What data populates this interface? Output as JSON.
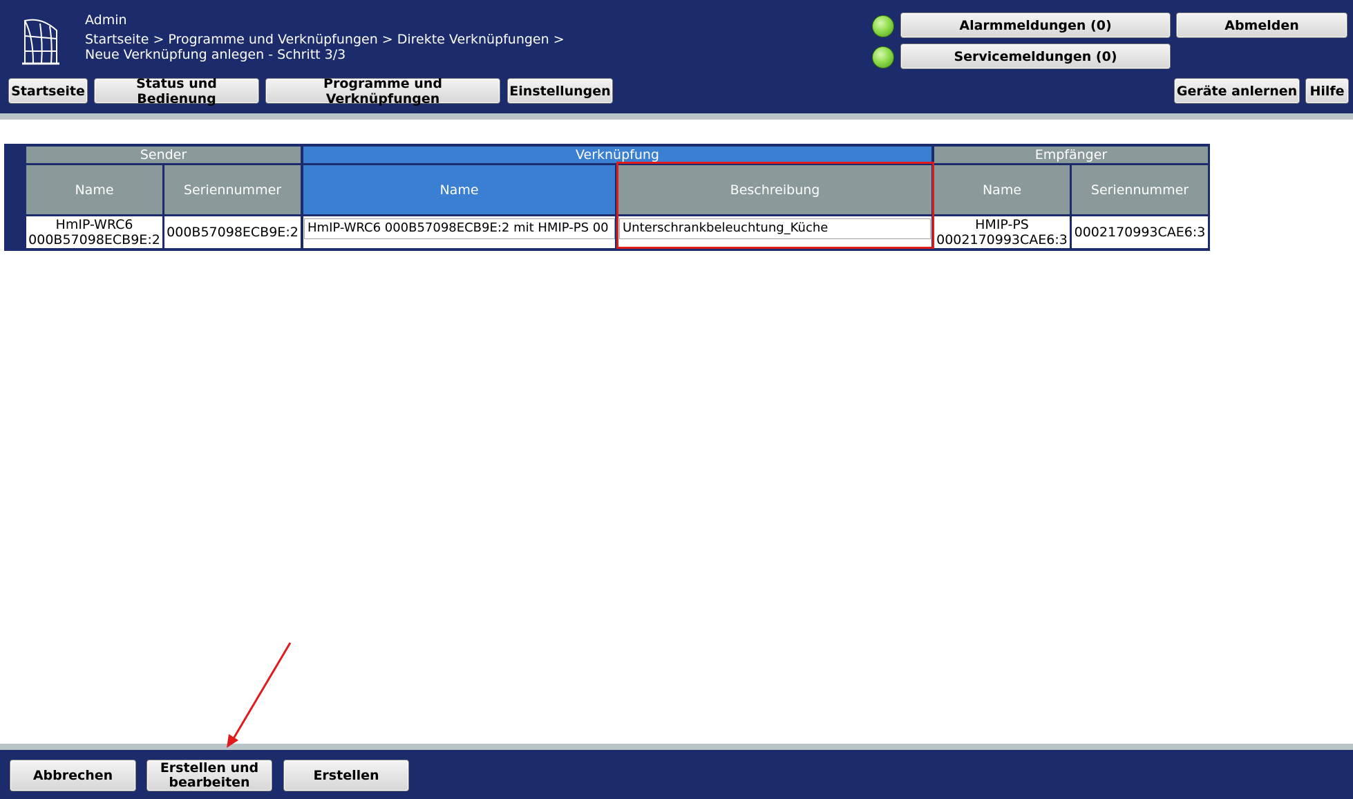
{
  "header": {
    "user": "Admin",
    "breadcrumb_line1": "Startseite > Programme und Verknüpfungen > Direkte Verknüpfungen >",
    "breadcrumb_line2": "Neue Verknüpfung anlegen - Schritt 3/3",
    "alarm_label": "Alarmmeldungen (0)",
    "service_label": "Servicemeldungen (0)",
    "logout_label": "Abmelden",
    "nav": [
      "Startseite",
      "Status und Bedienung",
      "Programme und Verknüpfungen",
      "Einstellungen"
    ],
    "teach_label": "Geräte anlernen",
    "help_label": "Hilfe",
    "status_colors": {
      "alarm_led": "#8fdc4c",
      "service_led": "#8fdc4c"
    }
  },
  "table": {
    "groups": {
      "sender": "Sender",
      "link": "Verknüpfung",
      "receiver": "Empfänger"
    },
    "columns": {
      "sender_name": "Name",
      "sender_serial": "Seriennummer",
      "link_name": "Name",
      "link_desc": "Beschreibung",
      "receiver_name": "Name",
      "receiver_serial": "Seriennummer"
    },
    "row": {
      "sender_name_l1": "HmIP-WRC6",
      "sender_name_l2": "000B57098ECB9E:2",
      "sender_serial": "000B57098ECB9E:2",
      "link_name_value": "HmIP-WRC6 000B57098ECB9E:2 mit HMIP-PS 00",
      "link_desc_value": "Unterschrankbeleuchtung_Küche",
      "receiver_name_l1": "HMIP-PS",
      "receiver_name_l2": "0002170993CAE6:3",
      "receiver_serial": "0002170993CAE6:3"
    }
  },
  "footer": {
    "cancel_label": "Abbrechen",
    "create_edit_l1": "Erstellen und",
    "create_edit_l2": "bearbeiten",
    "create_label": "Erstellen"
  },
  "colors": {
    "header_bg": "#1b2b6b",
    "table_header_gray": "#8a9a9b",
    "table_header_blue": "#3a7fd2",
    "annotation_red": "#e01b1b"
  }
}
